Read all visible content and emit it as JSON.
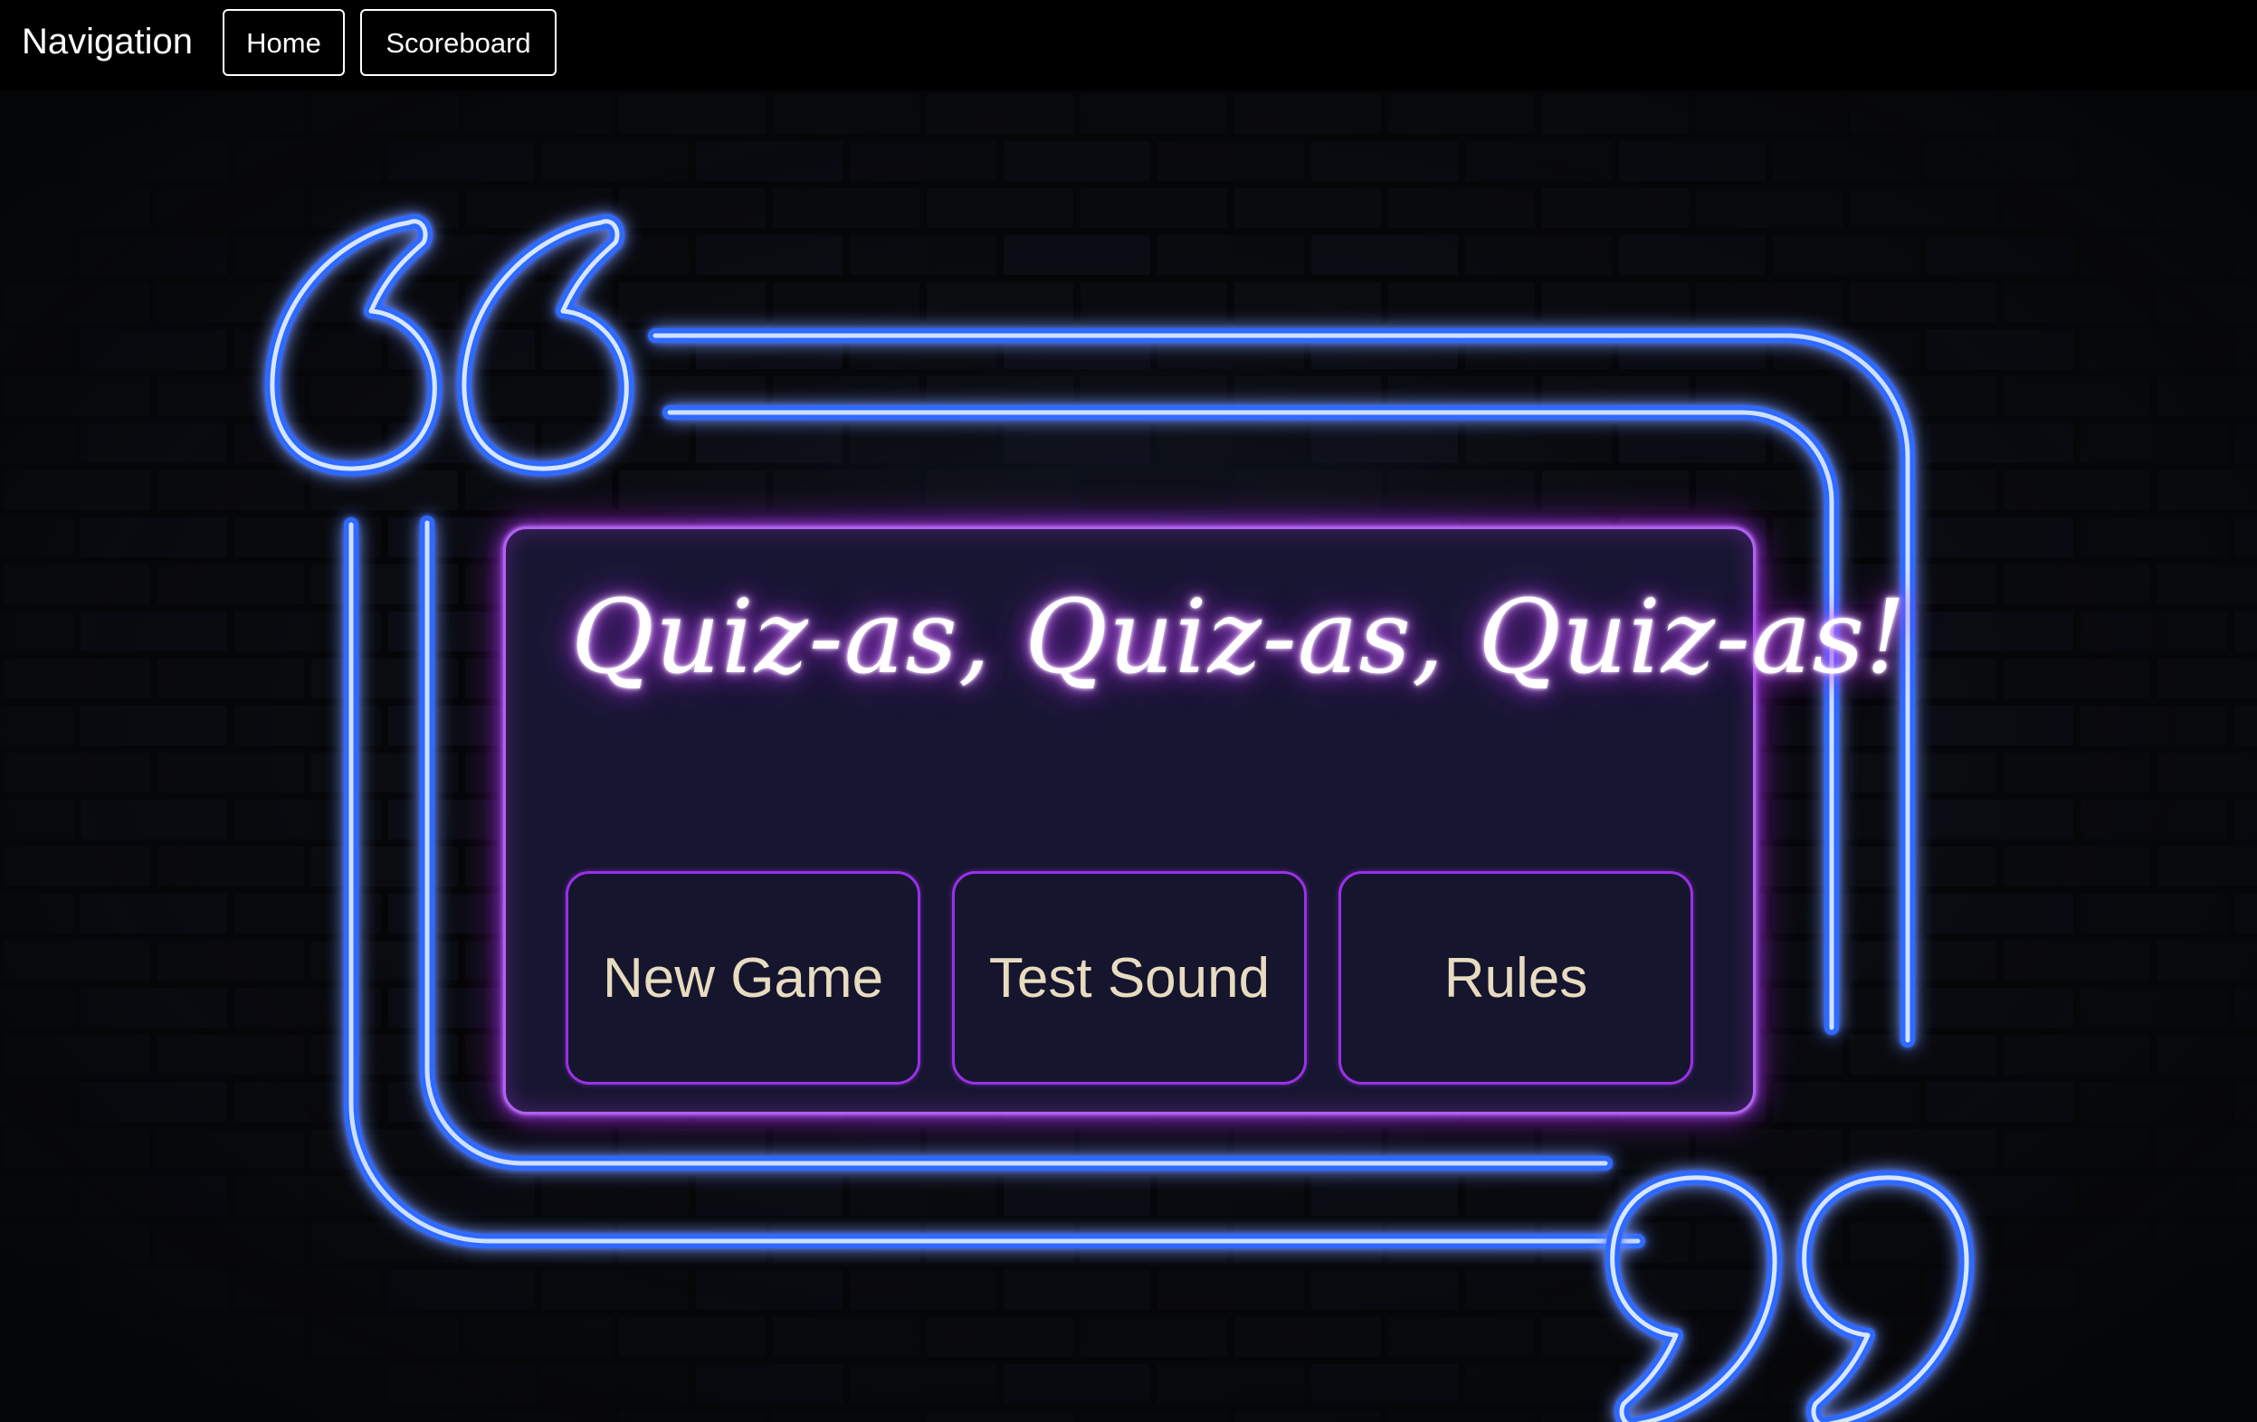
{
  "nav": {
    "title": "Navigation",
    "home_label": "Home",
    "scoreboard_label": "Scoreboard"
  },
  "game": {
    "title": "Quiz-as, Quiz-as, Quiz-as!",
    "buttons": {
      "new_game": "New Game",
      "test_sound": "Test Sound",
      "rules": "Rules"
    }
  },
  "icons": {
    "open_quote": "open-quote-icon",
    "close_quote": "close-quote-icon"
  },
  "colors": {
    "background": "#000000",
    "neon_blue": "#3a7cff",
    "neon_purple": "#b060f0",
    "panel": "#171631",
    "button_text": "#e8dcc0"
  }
}
